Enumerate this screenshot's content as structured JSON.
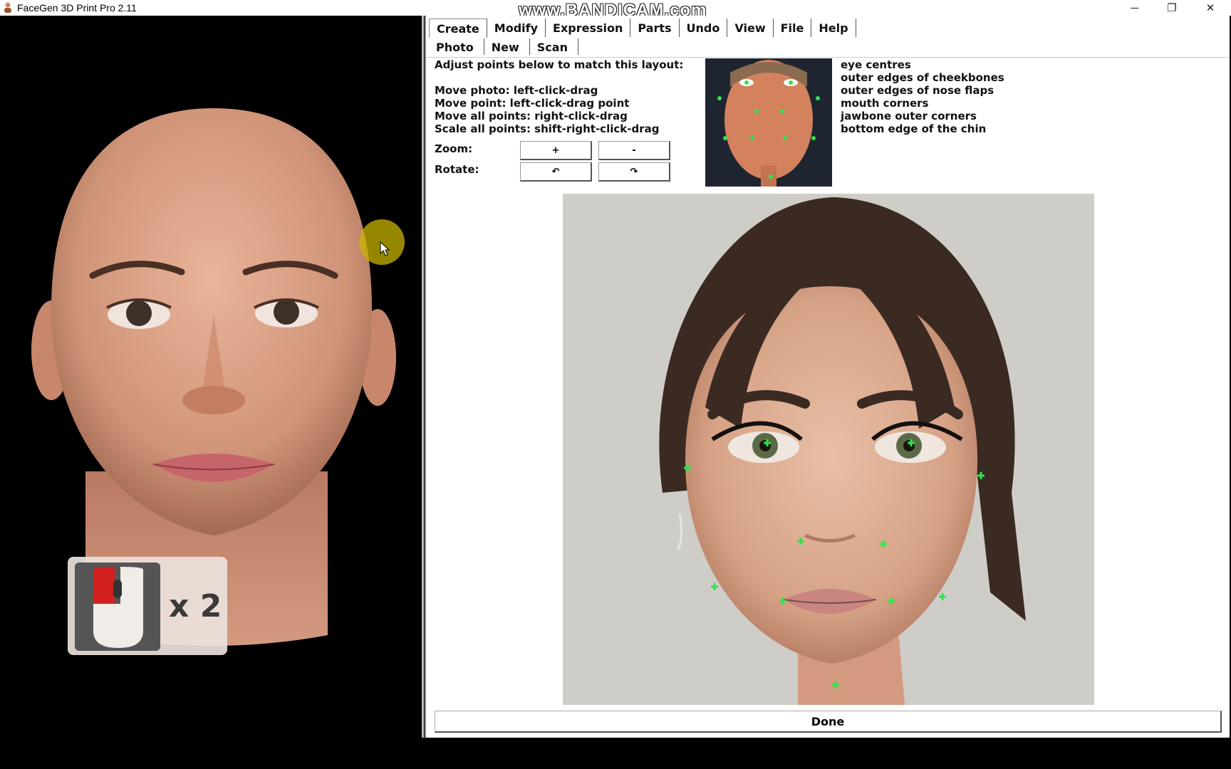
{
  "window": {
    "title": "FaceGen 3D Print Pro 2.11",
    "watermark": "www.BANDICAM.com",
    "minimize_glyph": "─",
    "restore_glyph": "❐",
    "close_glyph": "✕"
  },
  "menu": {
    "items": [
      "Create",
      "Modify",
      "Expression",
      "Parts",
      "Undo",
      "View",
      "File",
      "Help"
    ],
    "active": "Create"
  },
  "submenu": {
    "items": [
      "Photo",
      "New",
      "Scan"
    ],
    "active": "Photo"
  },
  "instructions": {
    "heading": "Adjust points below to match this layout:",
    "lines": [
      "Move photo: left-click-drag",
      "Move point: left-click-drag point",
      "Move all points: right-click-drag",
      "Scale all points: shift-right-click-drag"
    ]
  },
  "controls": {
    "zoom_label": "Zoom:",
    "zoom_in": "+",
    "zoom_out": "-",
    "rotate_label": "Rotate:",
    "rotate_ccw": "↶",
    "rotate_cw": "↷"
  },
  "legend": [
    "eye centres",
    "outer edges of cheekbones",
    "outer edges of nose flaps",
    "mouth corners",
    "jawbone outer corners",
    "bottom edge of the chin"
  ],
  "mouse_hint": {
    "count": "x 2",
    "icon": "mouse-right-click-icon"
  },
  "done_label": "Done",
  "colors": {
    "landmark": "#2ee64a",
    "cursor_highlight": "#c8b400",
    "mouse_button": "#d32020"
  }
}
